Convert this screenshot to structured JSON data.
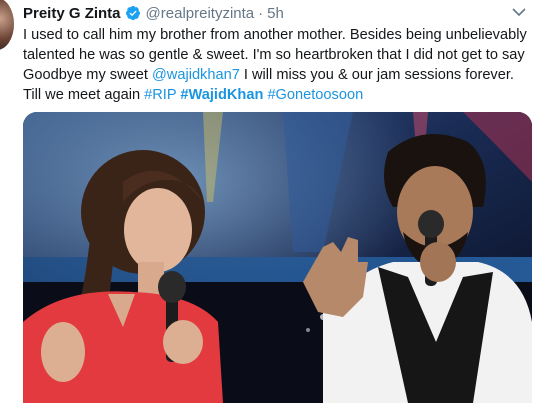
{
  "author": {
    "name": "Preity G Zinta",
    "handle": "@realpreityzinta",
    "separator": "·",
    "time": "5h"
  },
  "tweet": {
    "text_1": "I used to call him my brother from another mother. Besides being unbelievably talented he was so gentle & sweet. I'm so heartbroken that I did not get to say Goodbye my sweet ",
    "mention": "@wajidkhan7",
    "text_2": " I will miss you & our jam sessions forever. Till we meet again ",
    "hashtag_rip": "#RIP",
    "hashtag_wajid": "#WajidKhan",
    "hashtag_gone": "#Gonetoosoon"
  },
  "icons": {
    "verified": "verified-badge-icon",
    "caret": "chevron-down-icon"
  },
  "colors": {
    "link": "#1b95e0",
    "verified": "#1da1f2",
    "secondary_text": "#657786",
    "text": "#14171a"
  }
}
